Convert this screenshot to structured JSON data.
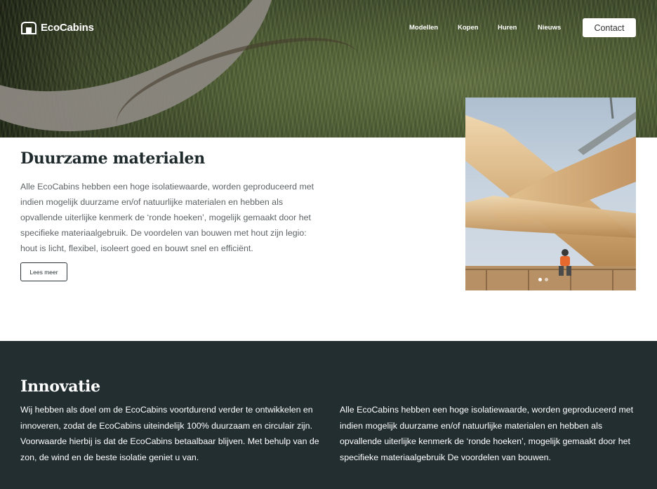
{
  "header": {
    "logo_text": "EcoCabins",
    "nav": [
      "Modellen",
      "Kopen",
      "Huren",
      "Nieuws"
    ],
    "contact_label": "Contact"
  },
  "materials": {
    "title": "Duurzame materialen",
    "body": "Alle EcoCabins hebben een hoge isolatiewaarde, worden geproduceerd met indien mogelijk duurzame en/of natuurlijke materialen en hebben als opvallende uiterlijke kenmerk de ‘ronde hoeken’, mogelijk gemaakt door het specifieke materiaalgebruik. De voordelen van bouwen met hout zijn legio: hout is licht, flexibel, isoleert goed en bouwt snel en efficiënt.",
    "button_label": "Lees meer"
  },
  "slider": {
    "slide_count": 2,
    "active_index": 0
  },
  "innovation": {
    "title": "Innovatie",
    "left_text": "Wij hebben als doel om de EcoCabins voortdurend verder te ontwikkelen en innoveren, zodat de EcoCabins uiteindelijk 100% duurzaam en circulair zijn. Voorwaarde hierbij is dat de EcoCabins betaalbaar blijven. Met behulp van de zon, de wind en de beste isolatie geniet u van.",
    "right_text": "Alle EcoCabins hebben een hoge isolatiewaarde, worden geproduceerd met indien mogelijk duurzame en/of natuurlijke materialen en hebben als opvallende uiterlijke kenmerk de ‘ronde hoeken’, mogelijk gemaakt door het specifieke materiaalgebruik De voordelen van bouwen."
  },
  "colors": {
    "dark_section": "#232e31",
    "heading": "#1f2a2c",
    "body_text": "#5e6466"
  }
}
